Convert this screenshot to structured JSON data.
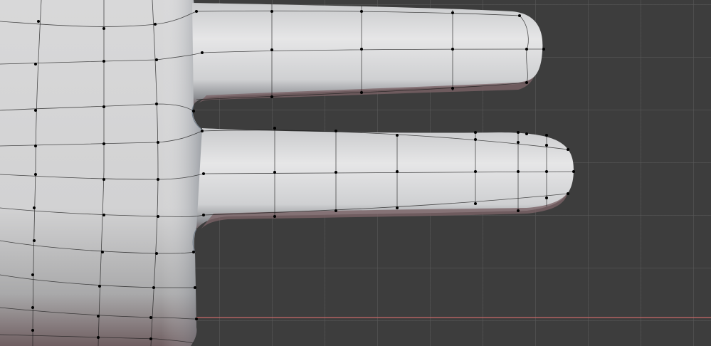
{
  "viewport": {
    "background_color": "#3d3d3d",
    "grid_color": "#5a5a5a",
    "x_axis_color": "#c86a6a",
    "mesh_color": "#d9dadb",
    "wire_color": "#1a1a1a",
    "vertex_color": "#000000"
  }
}
